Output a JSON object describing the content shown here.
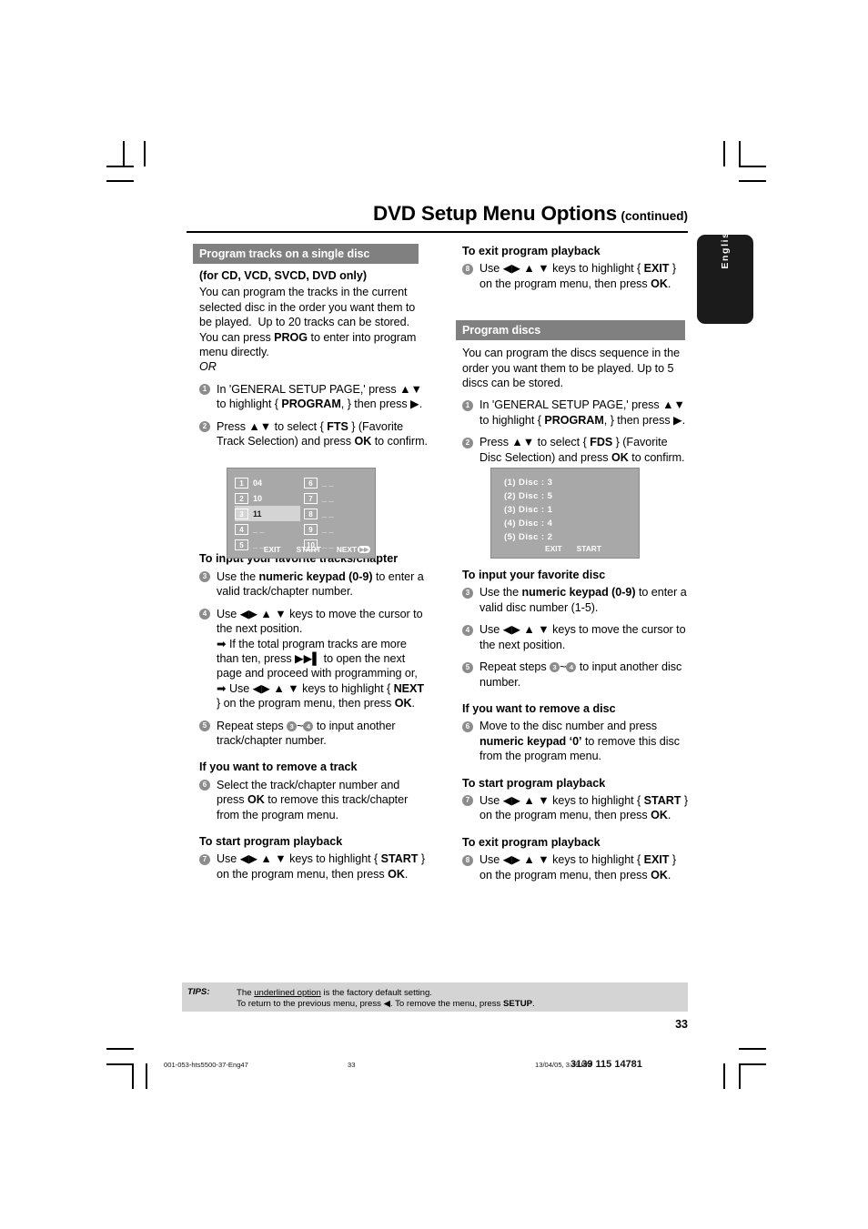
{
  "header": {
    "title": "DVD Setup Menu Options",
    "continued": "(continued)"
  },
  "language_tab": {
    "label": "English"
  },
  "left_column": {
    "section_bar": "Program tracks on a single disc",
    "intro_heading": "(for CD, VCD, SVCD, DVD only)",
    "intro_body": "You can program the tracks in the current selected disc in the order you want them to be played.  Up to 20 tracks can be stored. You can press PROG to enter into program menu directly.",
    "or_text": "OR",
    "step1": {
      "num": "1",
      "text_a": "In 'GENERAL SETUP PAGE,' press ",
      "arrows_updown": "▲▼",
      "text_b": " to highlight { ",
      "bold_item": "PROGRAM",
      "text_c": ", } then press ",
      "arrow_right": "▶",
      "text_d": "."
    },
    "step2": {
      "num": "2",
      "text_a": "Press ",
      "arrows_updown": "▲▼",
      "text_b": " to select { ",
      "bold_item": "FTS",
      "text_c": " } (Favorite Track Selection) and press ",
      "bold_ok": "OK",
      "text_d": " to confirm."
    },
    "sub_input": "To input your favorite tracks/chapter",
    "step3": {
      "num": "3",
      "text_a": "Use the ",
      "bold_item": "numeric keypad (0-9)",
      "text_b": " to enter a valid track/chapter number."
    },
    "step4": {
      "num": "4",
      "text_a": "Use ",
      "arrows": "◀▶ ▲ ▼",
      "text_b": " keys to move the cursor to the next position.",
      "note1_arrow": "➜",
      "note1_a": " If the total program tracks are more than ten, press ",
      "note1_icon": "▶▶▏",
      "note1_b": " to open the next page and proceed with programming or,",
      "note2_arrow": "➜",
      "note2_a": " Use ",
      "note2_arrows": "◀▶ ▲ ▼",
      "note2_b": " keys to highlight { ",
      "note2_bold": "NEXT",
      "note2_c": " } on the program menu, then press ",
      "note2_ok": "OK",
      "note2_d": "."
    },
    "step5": {
      "num": "5",
      "text_a": "Repeat steps ",
      "range_from": "3",
      "tilde": "~",
      "range_to": "4",
      "text_b": " to input another track/chapter number."
    },
    "sub_remove": "If you want to remove a track",
    "step6": {
      "num": "6",
      "text_a": "Select the track/chapter number and press ",
      "bold_ok": "OK",
      "text_b": " to remove this track/chapter from the program menu."
    },
    "sub_start": "To start program playback",
    "step7": {
      "num": "7",
      "text_a": "Use ",
      "arrows": "◀▶ ▲ ▼",
      "text_b": " keys to highlight { ",
      "bold_item": "START",
      "text_c": " } on the program menu, then press ",
      "bold_ok": "OK",
      "text_d": "."
    }
  },
  "right_column": {
    "sub_exit_top": "To exit program playback",
    "step8_top": {
      "num": "8",
      "text_a": "Use ",
      "arrows": "◀▶ ▲ ▼",
      "text_b": " keys to highlight { ",
      "bold_item": "EXIT",
      "text_c": " } on the program menu, then press ",
      "bold_ok": "OK",
      "text_d": "."
    },
    "section_bar": "Program discs",
    "intro_body": "You can program the discs sequence in the order you want them to be played. Up  to 5 discs can be stored.",
    "step1": {
      "num": "1",
      "text_a": "In 'GENERAL SETUP PAGE,' press ",
      "arrows_updown": "▲▼",
      "text_b": " to highlight { ",
      "bold_item": "PROGRAM",
      "text_c": ", } then press ",
      "arrow_right": "▶",
      "text_d": "."
    },
    "step2": {
      "num": "2",
      "text_a": "Press ",
      "arrows_updown": "▲▼",
      "text_b": " to select { ",
      "bold_item": "FDS",
      "text_c": " } (Favorite Disc Selection) and press ",
      "bold_ok": "OK",
      "text_d": " to confirm."
    },
    "sub_input": "To input your favorite disc",
    "step3": {
      "num": "3",
      "text_a": "Use the ",
      "bold_item": "numeric keypad (0-9)",
      "text_b": " to enter a valid disc number (1-5)."
    },
    "step4": {
      "num": "4",
      "text_a": "Use ",
      "arrows": "◀▶ ▲ ▼",
      "text_b": " keys to move the cursor to the next position."
    },
    "step5": {
      "num": "5",
      "text_a": "Repeat steps ",
      "range_from": "3",
      "tilde": "~",
      "range_to": "4",
      "text_b": " to input another disc number."
    },
    "sub_remove": "If you want to remove a disc",
    "step6": {
      "num": "6",
      "text_a": "Move to the disc number and press ",
      "bold_item": "numeric keypad '0'",
      "text_b": " to remove this disc from the program menu."
    },
    "sub_start": "To start program playback",
    "step7": {
      "num": "7",
      "text_a": "Use ",
      "arrows": "◀▶ ▲ ▼",
      "text_b": " keys to highlight { ",
      "bold_item": "START",
      "text_c": " } on the program menu, then press ",
      "bold_ok": "OK",
      "text_d": "."
    },
    "sub_exit": "To exit program playback",
    "step8": {
      "num": "8",
      "text_a": "Use ",
      "arrows": "◀▶ ▲ ▼",
      "text_b": " keys to highlight { ",
      "bold_item": "EXIT",
      "text_c": " } on the program menu, then press ",
      "bold_ok": "OK",
      "text_d": "."
    }
  },
  "osd_tracks": {
    "column1": [
      {
        "num": "1",
        "value": "04",
        "selected": false
      },
      {
        "num": "2",
        "value": "10",
        "selected": false
      },
      {
        "num": "3",
        "value": "11",
        "selected": true
      },
      {
        "num": "4",
        "value": "_ _",
        "selected": false
      },
      {
        "num": "5",
        "value": "_ _",
        "selected": false
      }
    ],
    "column2": [
      {
        "num": "6",
        "value": "_ _",
        "selected": false
      },
      {
        "num": "7",
        "value": "_ _",
        "selected": false
      },
      {
        "num": "8",
        "value": "_ _",
        "selected": false
      },
      {
        "num": "9",
        "value": "_ _",
        "selected": false
      },
      {
        "num": "10",
        "value": "_ _",
        "selected": false
      }
    ],
    "buttons": {
      "exit": "EXIT",
      "start": "START",
      "next": "NEXT",
      "next_badge": "▶▶"
    }
  },
  "osd_discs": {
    "rows": [
      "(1)  Disc : 3",
      "(2)  Disc : 5",
      "(3)  Disc : 1",
      "(4)  Disc : 4",
      "(5)  Disc : 2"
    ],
    "buttons": {
      "exit": "EXIT",
      "start": "START"
    }
  },
  "tips": {
    "label": "TIPS:",
    "line1_a": "The ",
    "line1_underlined": "underlined option",
    "line1_b": " is the factory default setting.",
    "line2_a": "To return to the previous menu, press ",
    "line2_arrow": "◀",
    "line2_b": ". To remove the menu, press ",
    "line2_bold": "SETUP",
    "line2_c": "."
  },
  "page_number": "33",
  "print_footer": {
    "file": "001-053-hts5500-37-Eng47",
    "page": "33",
    "date": "13/04/05, 3:39 PM",
    "code": "3139 115 14781"
  },
  "colors": {
    "section_bar": "#808080",
    "osd_background": "#a8a8a8",
    "osd_highlight": "#d4d4d4",
    "tips_background": "#d4d4d4",
    "bullet": "#8c8c8c",
    "tab": "#1b1b1b"
  }
}
